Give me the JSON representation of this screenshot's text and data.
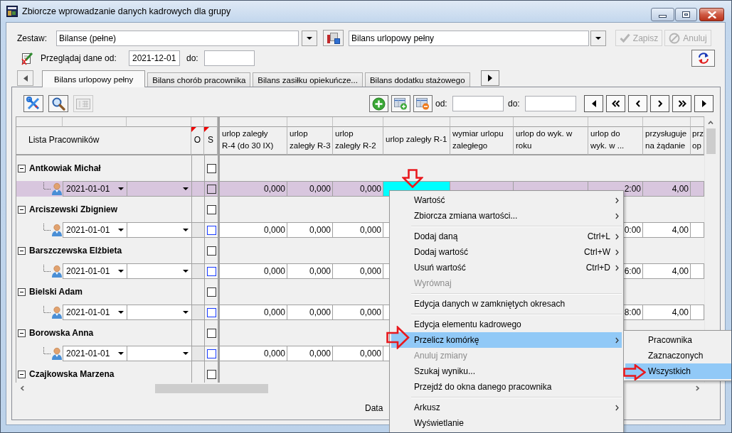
{
  "window": {
    "title": "Zbiorcze wprowadzanie danych kadrowych dla grupy"
  },
  "set_selector": {
    "label": "Zestaw:",
    "value": "Bilanse (pełne)"
  },
  "sheet_selector": {
    "value": "Bilans urlopowy pełny"
  },
  "actions": [
    {
      "kind": "save",
      "label": "Zapisz",
      "disabled": true
    },
    {
      "kind": "cancel",
      "label": "Anuluj",
      "disabled": true
    }
  ],
  "date_filter": {
    "label": "Przeglądaj dane od:",
    "from": "2021-12-01",
    "to_label": "do:"
  },
  "tabs": [
    {
      "label": "Bilans urlopowy pełny",
      "selected": true
    },
    {
      "label": "Bilans chorób pracownika",
      "selected": false
    },
    {
      "label": "Bilans zasiłku opiekuńcze...",
      "selected": false
    },
    {
      "label": "Bilans dodatku stażowego",
      "selected": false
    }
  ],
  "grid_toolbar": {
    "tools": [
      {
        "kind": "tools",
        "disabled": false
      },
      {
        "kind": "search",
        "disabled": false
      },
      {
        "kind": "calculator",
        "disabled": true
      }
    ],
    "from_label": "od:",
    "to_label": "do:"
  },
  "table": {
    "tree_header": "Lista Pracowników",
    "flag_columns": [
      "O",
      "S"
    ],
    "columns": [
      "urlop zaległy R-4 (do 30 IX)",
      "urlop zaległy R-3",
      "urlop zaległy R-2",
      "urlop zaległy R-1",
      "wymiar urlopu zaległego",
      "urlop do wyk. w roku",
      "urlop do wyk. w ...",
      "przysługuje na żądanie",
      "prz op"
    ],
    "employees": [
      {
        "name": "Antkowiak Michał",
        "expanded": true,
        "checked": false,
        "entries": [
          {
            "date": "2021-01-01",
            "selected": true,
            "checked": false,
            "cells": [
              {
                "kind": "value",
                "text": "0,000"
              },
              {
                "kind": "value",
                "text": "0,000"
              },
              {
                "kind": "value",
                "text": "0,000"
              },
              {
                "kind": "focused"
              },
              {
                "kind": "value"
              },
              {
                "kind": "value"
              },
              {
                "kind": "value",
                "text": "2:00"
              },
              {
                "kind": "value",
                "text": "4,00"
              },
              {
                "kind": "value"
              }
            ]
          }
        ]
      },
      {
        "name": "Arciszewski Zbigniew",
        "expanded": true,
        "checked": false,
        "entries": [
          {
            "date": "2021-01-01",
            "selected": false,
            "checked": false,
            "cells": [
              {
                "kind": "value",
                "text": "0,000"
              },
              {
                "kind": "value",
                "text": "0,000"
              },
              {
                "kind": "value",
                "text": "0,000"
              },
              {
                "kind": "value"
              },
              {
                "kind": "value"
              },
              {
                "kind": "value"
              },
              {
                "kind": "value",
                "text": "0:00"
              },
              {
                "kind": "value",
                "text": "4,00"
              },
              {
                "kind": "value"
              }
            ]
          }
        ]
      },
      {
        "name": "Barszczewska Elżbieta",
        "expanded": true,
        "checked": false,
        "entries": [
          {
            "date": "2021-01-01",
            "selected": false,
            "checked": false,
            "cells": [
              {
                "kind": "value",
                "text": "0,000"
              },
              {
                "kind": "value",
                "text": "0,000"
              },
              {
                "kind": "value",
                "text": "0,000"
              },
              {
                "kind": "value"
              },
              {
                "kind": "value"
              },
              {
                "kind": "value"
              },
              {
                "kind": "value",
                "text": "6:00"
              },
              {
                "kind": "value",
                "text": "4,00"
              },
              {
                "kind": "value"
              }
            ]
          }
        ]
      },
      {
        "name": "Bielski Adam",
        "expanded": true,
        "checked": false,
        "entries": [
          {
            "date": "2021-01-01",
            "selected": false,
            "checked": false,
            "cells": [
              {
                "kind": "value",
                "text": "0,000"
              },
              {
                "kind": "value",
                "text": "0,000"
              },
              {
                "kind": "value",
                "text": "0,000"
              },
              {
                "kind": "value"
              },
              {
                "kind": "value"
              },
              {
                "kind": "value"
              },
              {
                "kind": "value",
                "text": "8:00"
              },
              {
                "kind": "value",
                "text": "4,00"
              },
              {
                "kind": "value"
              }
            ]
          }
        ]
      },
      {
        "name": "Borowska Anna",
        "expanded": true,
        "checked": false,
        "entries": [
          {
            "date": "2021-01-01",
            "selected": false,
            "checked": false,
            "cells": [
              {
                "kind": "value",
                "text": "0,000"
              },
              {
                "kind": "value",
                "text": "0,000"
              },
              {
                "kind": "value",
                "text": "0,000"
              },
              {
                "kind": "value"
              },
              {
                "kind": "value"
              },
              {
                "kind": "value"
              },
              {
                "kind": "value"
              },
              {
                "kind": "value"
              },
              {
                "kind": "value"
              }
            ]
          }
        ]
      },
      {
        "name": "Czajkowska Marzena",
        "expanded": true,
        "checked": false
      }
    ]
  },
  "context_menu": {
    "items": [
      {
        "kind": "item",
        "label": "Wartość",
        "submenu": true,
        "disabled": false,
        "selected": false
      },
      {
        "kind": "item",
        "label": "Zbiorcza zmiana wartości...",
        "submenu": true,
        "disabled": false,
        "selected": false
      },
      {
        "kind": "separator"
      },
      {
        "kind": "item",
        "label": "Dodaj daną",
        "shortcut": "Ctrl+L",
        "submenu": true,
        "disabled": false,
        "selected": false
      },
      {
        "kind": "item",
        "label": "Dodaj wartość",
        "shortcut": "Ctrl+W",
        "submenu": true,
        "disabled": false,
        "selected": false
      },
      {
        "kind": "item",
        "label": "Usuń wartość",
        "shortcut": "Ctrl+D",
        "submenu": true,
        "disabled": false,
        "selected": false
      },
      {
        "kind": "item",
        "label": "Wyrównaj",
        "submenu": false,
        "disabled": true,
        "selected": false
      },
      {
        "kind": "separator"
      },
      {
        "kind": "item",
        "label": "Edycja danych w zamkniętych okresach",
        "submenu": false,
        "disabled": false,
        "selected": false
      },
      {
        "kind": "separator"
      },
      {
        "kind": "item",
        "label": "Edycja elementu kadrowego",
        "submenu": false,
        "disabled": false,
        "selected": false
      },
      {
        "kind": "item",
        "label": "Przelicz komórkę",
        "submenu": true,
        "disabled": false,
        "selected": true
      },
      {
        "kind": "item",
        "label": "Anuluj zmiany",
        "submenu": false,
        "disabled": true,
        "selected": false
      },
      {
        "kind": "item",
        "label": "Szukaj wyniku...",
        "submenu": false,
        "disabled": false,
        "selected": false
      },
      {
        "kind": "item",
        "label": "Przejdź do okna danego pracownika",
        "submenu": false,
        "disabled": false,
        "selected": false
      },
      {
        "kind": "separator"
      },
      {
        "kind": "item",
        "label": "Arkusz",
        "submenu": true,
        "disabled": false,
        "selected": false
      },
      {
        "kind": "item",
        "label": "Wyświetlanie",
        "submenu": false,
        "disabled": false,
        "selected": false
      }
    ]
  },
  "submenu": {
    "items": [
      {
        "label": "Pracownika",
        "selected": false
      },
      {
        "label": "Zaznaczonych",
        "selected": false
      },
      {
        "label": "Wszystkich",
        "selected": true
      }
    ]
  },
  "footer": {
    "text": "Data"
  }
}
